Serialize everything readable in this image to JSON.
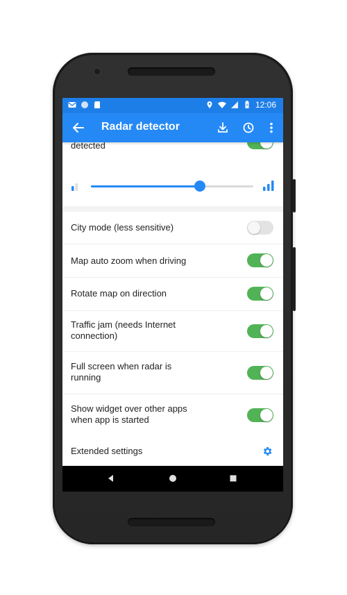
{
  "statusbar": {
    "time": "12:06",
    "left_icons": [
      "gmail-icon",
      "circle-icon",
      "sd-card-icon"
    ],
    "right_icons": [
      "location-icon",
      "wifi-icon",
      "signal-icon",
      "battery-icon"
    ]
  },
  "appbar": {
    "title": "Radar detector",
    "actions": [
      "download-icon",
      "history-icon",
      "more-vert-icon"
    ]
  },
  "settings": {
    "partial_label": "detected",
    "partial_toggle_on": true,
    "sensitivity_percent": 67,
    "items": [
      {
        "label": "City mode (less sensitive)",
        "on": false
      },
      {
        "label": "Map auto zoom when driving",
        "on": true
      },
      {
        "label": "Rotate map on direction",
        "on": true
      },
      {
        "label": "Traffic jam (needs Internet connection)",
        "on": true
      },
      {
        "label": "Full screen when radar is running",
        "on": true
      },
      {
        "label": "Show widget over other apps when app is started",
        "on": true
      }
    ],
    "extended_label": "Extended settings"
  },
  "colors": {
    "primary": "#2589f5",
    "status_bar": "#1e7ee8",
    "toggle_on": "#52b356",
    "toggle_off": "#e3e3e3"
  },
  "navbar": [
    "back-triangle-icon",
    "home-circle-icon",
    "recents-square-icon"
  ]
}
